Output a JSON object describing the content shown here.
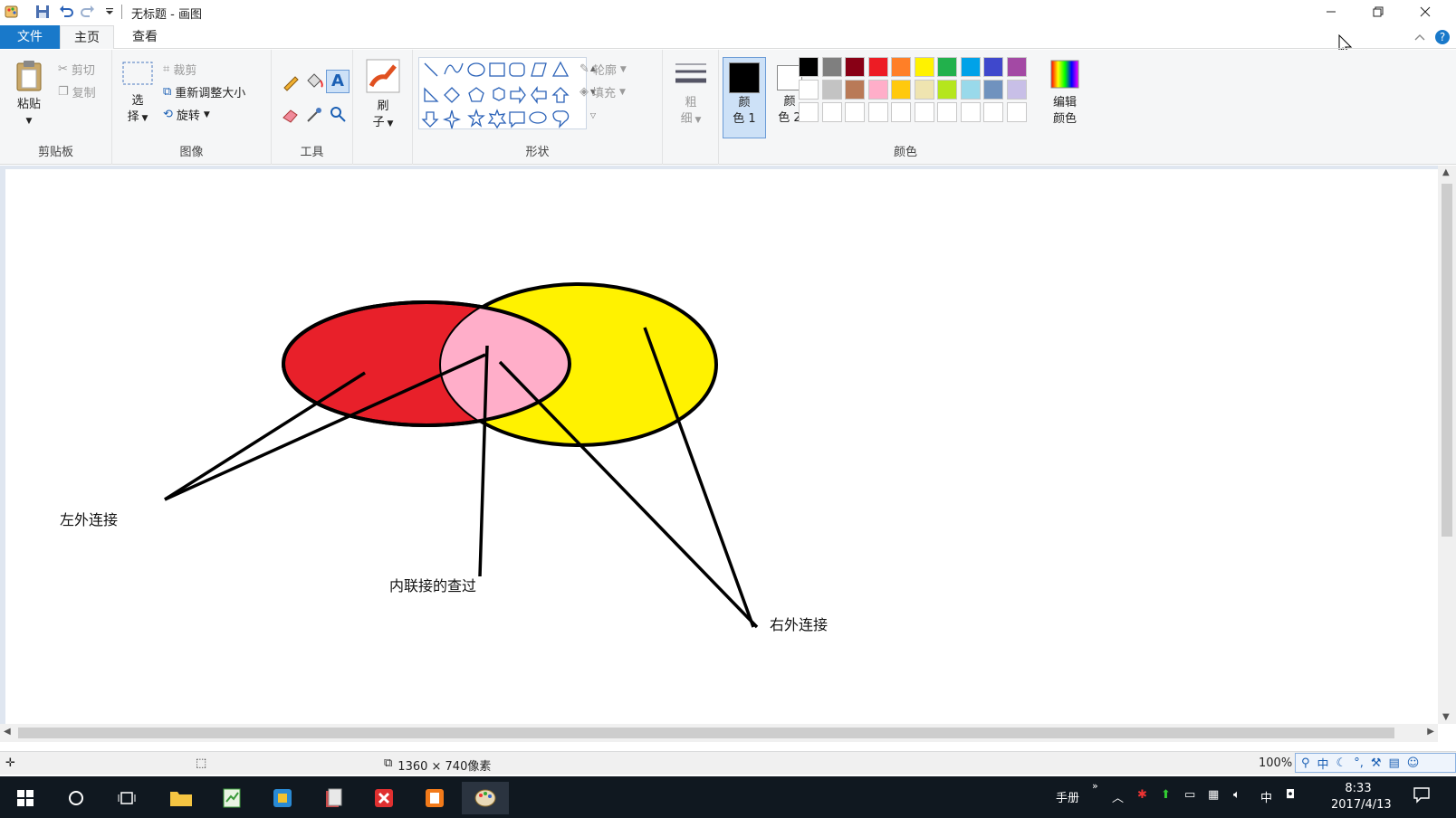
{
  "window": {
    "title": "无标题 - 画图"
  },
  "tabs": {
    "file": "文件",
    "home": "主页",
    "view": "查看"
  },
  "ribbon": {
    "clipboard": {
      "paste": "粘贴",
      "cut": "剪切",
      "copy": "复制",
      "label": "剪贴板"
    },
    "image": {
      "select_1": "选",
      "select_2": "择",
      "crop": "裁剪",
      "resize": "重新调整大小",
      "rotate": "旋转",
      "label": "图像"
    },
    "tools": {
      "label": "工具"
    },
    "brush": {
      "label_1": "刷",
      "label_2": "子"
    },
    "shapes": {
      "outline": "轮廓",
      "fill": "填充",
      "label": "形状"
    },
    "size": {
      "label_1": "粗",
      "label_2": "细"
    },
    "colors": {
      "color1_1": "颜",
      "color1_2": "色 1",
      "color2_1": "颜",
      "color2_2": "色 2",
      "edit_1": "编辑",
      "edit_2": "颜色",
      "label": "颜色",
      "color1_value": "#000000",
      "color2_value": "#ffffff",
      "palette_row1": [
        "#000000",
        "#7f7f7f",
        "#880015",
        "#ed1c24",
        "#ff7f27",
        "#fff200",
        "#22b14c",
        "#00a2e8",
        "#3f48cc",
        "#a349a4"
      ],
      "palette_row2": [
        "#ffffff",
        "#c3c3c3",
        "#b97a57",
        "#ffaec9",
        "#ffc90e",
        "#efe4b0",
        "#b5e61d",
        "#99d9ea",
        "#7092be",
        "#c8bfe7"
      ],
      "palette_row3": [
        "#ffffff",
        "#ffffff",
        "#ffffff",
        "#ffffff",
        "#ffffff",
        "#ffffff",
        "#ffffff",
        "#ffffff",
        "#ffffff",
        "#ffffff"
      ]
    }
  },
  "canvas": {
    "labels": {
      "left": "左外连接",
      "inner": "内联接的查过",
      "right": "右外连接"
    },
    "colors": {
      "left_circle": "#e8202a",
      "right_circle": "#fff200",
      "overlap": "#ffaec9"
    }
  },
  "status": {
    "dimensions": "1360 × 740像素",
    "zoom": "100%"
  },
  "ime": {
    "mode": "中"
  },
  "taskbar": {
    "tray_text": "手册",
    "lang": "中",
    "time": "8:33",
    "date": "2017/4/13"
  }
}
